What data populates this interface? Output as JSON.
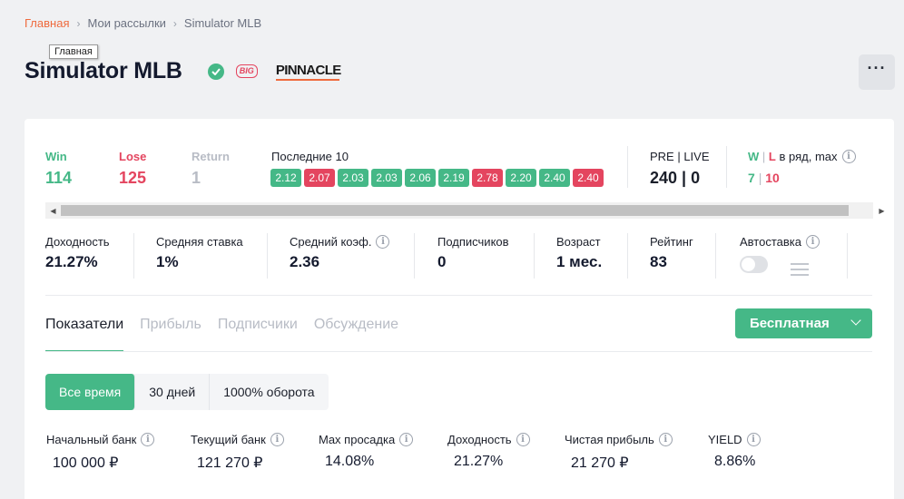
{
  "breadcrumb": {
    "home": "Главная",
    "mailings": "Мои рассылки",
    "current": "Simulator MLB",
    "tooltip": "Главная"
  },
  "header": {
    "title": "Simulator MLB",
    "big_badge": "BIG",
    "bookmaker": "PINNACLE",
    "menu_label": "···"
  },
  "top_stats": {
    "win_label": "Win",
    "win": "114",
    "lose_label": "Lose",
    "lose": "125",
    "return_label": "Return",
    "return": "1",
    "last10_label": "Последние 10",
    "last10": [
      {
        "value": "2.12",
        "result": "w"
      },
      {
        "value": "2.07",
        "result": "l"
      },
      {
        "value": "2.03",
        "result": "w"
      },
      {
        "value": "2.03",
        "result": "w"
      },
      {
        "value": "2.06",
        "result": "w"
      },
      {
        "value": "2.19",
        "result": "w"
      },
      {
        "value": "2.78",
        "result": "l"
      },
      {
        "value": "2.20",
        "result": "w"
      },
      {
        "value": "2.40",
        "result": "w"
      },
      {
        "value": "2.40",
        "result": "l"
      }
    ],
    "prelive_label": "PRE | LIVE",
    "prelive": "240 | 0",
    "streak_w": "W",
    "streak_sep": "|",
    "streak_l": "L",
    "streak_label": "в ряд, max",
    "streak_win": "7",
    "streak_lose": "10"
  },
  "mid_stats": {
    "yield_label": "Доходность",
    "yield": "21.27%",
    "avg_stake_label": "Средняя ставка",
    "avg_stake": "1%",
    "avg_odds_label": "Средний коэф.",
    "avg_odds": "2.36",
    "subscribers_label": "Подписчиков",
    "subscribers": "0",
    "age_label": "Возраст",
    "age": "1 мес.",
    "rating_label": "Рейтинг",
    "rating": "83",
    "autobet_label": "Автоставка"
  },
  "tabs": [
    "Показатели",
    "Прибыль",
    "Подписчики",
    "Обсуждение"
  ],
  "plan_button": "Бесплатная",
  "periods": [
    "Все время",
    "30 дней",
    "1000% оборота"
  ],
  "bottom_stats": {
    "start_bank_label": "Начальный банк",
    "start_bank": "100 000 ₽",
    "current_bank_label": "Текущий банк",
    "current_bank": "121 270 ₽",
    "max_drawdown_label": "Max просадка",
    "max_drawdown": "14.08%",
    "yield_label": "Доходность",
    "yield": "21.27%",
    "net_profit_label": "Чистая прибыль",
    "net_profit": "21 270 ₽",
    "yield2_label": "YIELD",
    "yield2": "8.86%"
  },
  "colors": {
    "green": "#45b887",
    "red": "#e4455f",
    "orange": "#ef6a3d"
  }
}
